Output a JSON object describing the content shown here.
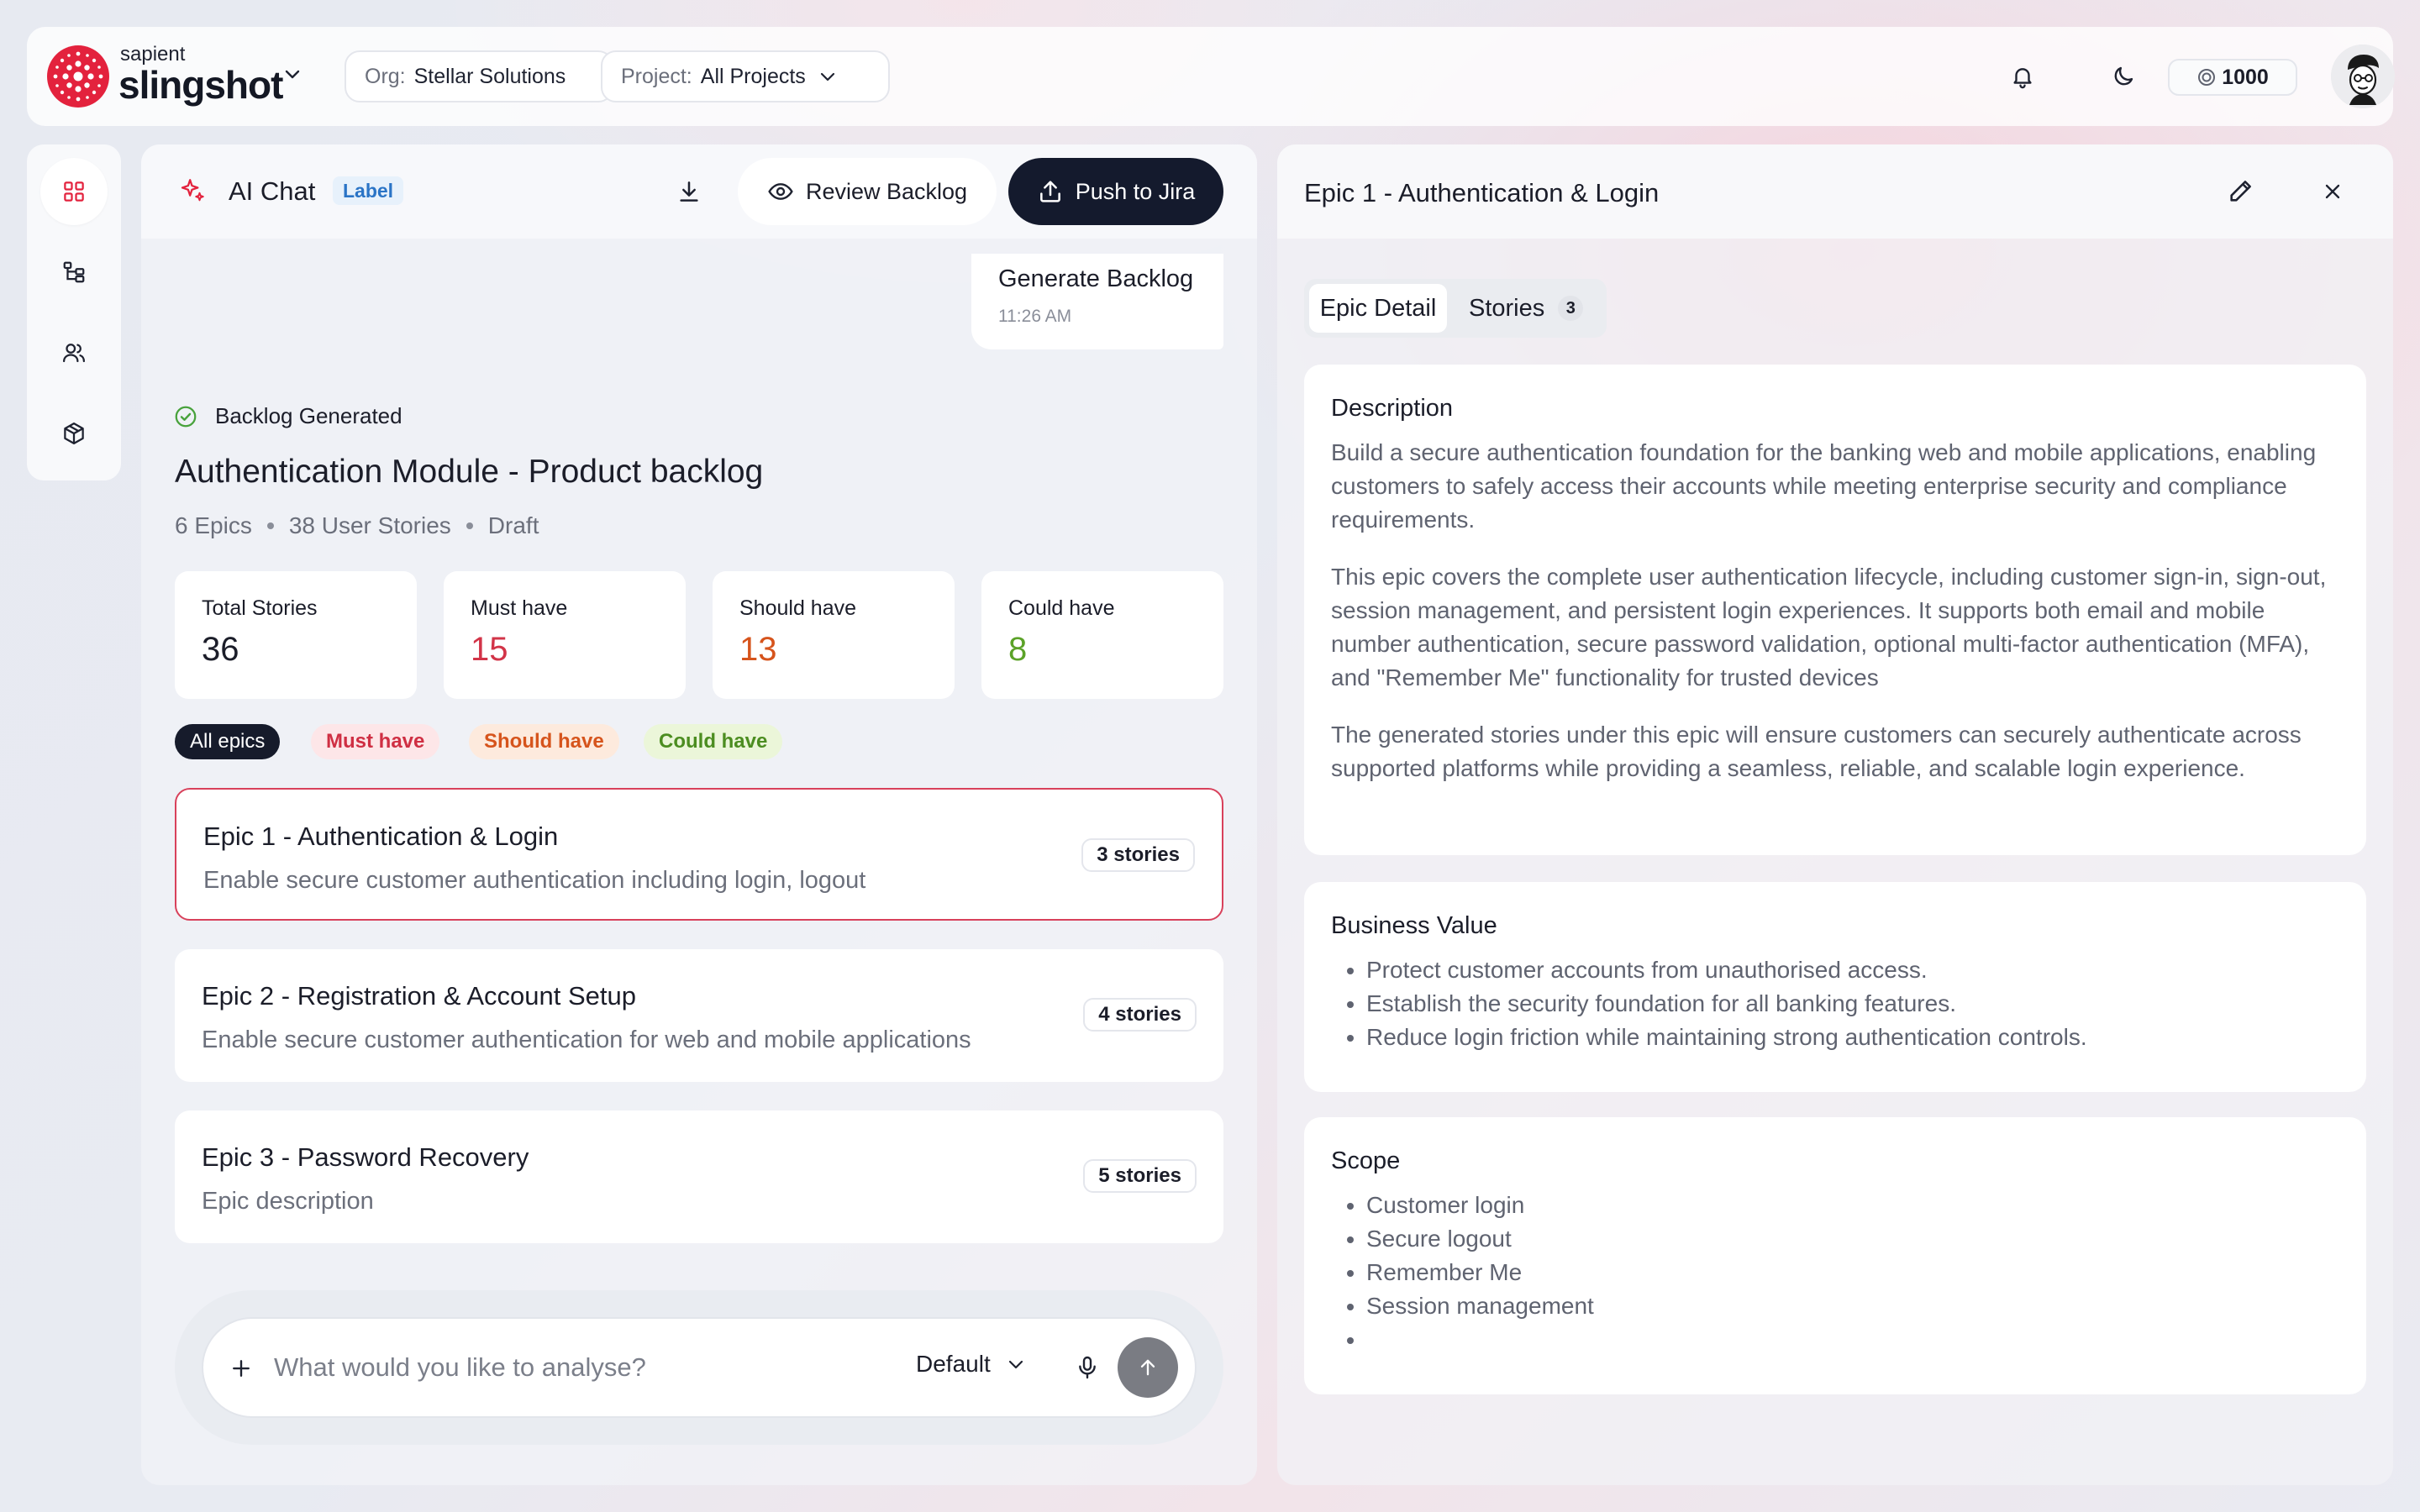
{
  "header": {
    "logo_small": "sapient",
    "logo_big": "slingshot",
    "org_label": "Org:",
    "org_value": "Stellar Solutions",
    "project_label": "Project:",
    "project_value": "All Projects",
    "credits": "1000"
  },
  "sidebar": {
    "items": [
      {
        "icon": "grid-icon",
        "active": true
      },
      {
        "icon": "hierarchy-icon"
      },
      {
        "icon": "users-icon"
      },
      {
        "icon": "box-icon"
      }
    ]
  },
  "chat": {
    "title": "AI Chat",
    "label": "Label",
    "review_label": "Review Backlog",
    "push_label": "Push to Jira",
    "message": {
      "text": "Generate Backlog",
      "time": "11:26 AM"
    },
    "status": "Backlog Generated",
    "backlog_title": "Authentication Module - Product backlog",
    "meta": {
      "epics": "6 Epics",
      "stories": "38 User Stories",
      "state": "Draft"
    },
    "stats": [
      {
        "label": "Total Stories",
        "value": "36",
        "color": "#1b1d29"
      },
      {
        "label": "Must have",
        "value": "15",
        "color": "#d23448"
      },
      {
        "label": "Should have",
        "value": "13",
        "color": "#d6541c"
      },
      {
        "label": "Could have",
        "value": "8",
        "color": "#5ba228"
      }
    ],
    "filters": [
      "All epics",
      "Must have",
      "Should have",
      "Could have"
    ],
    "epics": [
      {
        "title": "Epic 1 - Authentication & Login",
        "desc": "Enable secure customer authentication including login, logout",
        "count": "3 stories"
      },
      {
        "title": "Epic 2 - Registration & Account Setup",
        "desc": "Enable secure customer authentication for web and mobile applications",
        "count": "4 stories"
      },
      {
        "title": "Epic 3 - Password Recovery",
        "desc": "Epic description",
        "count": "5 stories"
      }
    ],
    "composer": {
      "placeholder": "What would you like to analyse?",
      "mode": "Default"
    }
  },
  "detail": {
    "title": "Epic 1 - Authentication & Login",
    "tabs": {
      "detail": "Epic Detail",
      "stories": "Stories",
      "stories_count": "3"
    },
    "description": {
      "heading": "Description",
      "paragraphs": [
        "Build a secure authentication foundation for the banking web and mobile applications, enabling customers to safely access their accounts while meeting enterprise security and compliance requirements.",
        "This epic covers the complete user authentication lifecycle, including customer sign-in, sign-out, session management, and persistent login experiences. It supports both email and mobile number authentication, secure password validation, optional multi-factor authentication (MFA), and \"Remember Me\" functionality for trusted devices",
        "The generated stories under this epic will ensure customers can securely authenticate across supported platforms while providing a seamless, reliable, and scalable login experience."
      ]
    },
    "business_value": {
      "heading": "Business Value",
      "items": [
        "Protect customer accounts from unauthorised access.",
        "Establish the security foundation for all banking features.",
        "Reduce login friction while maintaining strong authentication controls."
      ]
    },
    "scope": {
      "heading": "Scope",
      "items": [
        "Customer login",
        "Secure logout",
        "Remember Me",
        "Session management",
        ""
      ]
    }
  }
}
